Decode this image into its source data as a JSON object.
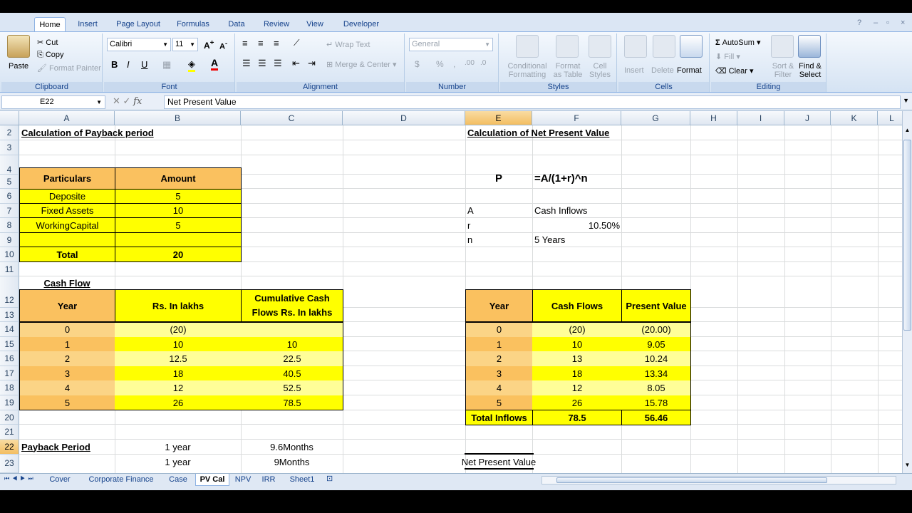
{
  "ribbon_tabs": [
    "Home",
    "Insert",
    "Page Layout",
    "Formulas",
    "Data",
    "Review",
    "View",
    "Developer"
  ],
  "clipboard": {
    "paste": "Paste",
    "cut": "Cut",
    "copy": "Copy",
    "format_painter": "Format Painter",
    "label": "Clipboard"
  },
  "font": {
    "name": "Calibri",
    "size": "11",
    "bold": "B",
    "italic": "I",
    "underline": "U",
    "label": "Font"
  },
  "alignment": {
    "wrap_text": "Wrap Text",
    "merge_center": "Merge & Center",
    "label": "Alignment"
  },
  "number": {
    "format": "General",
    "currency": "$",
    "percent": "%",
    "comma": ",",
    "label": "Number"
  },
  "styles": {
    "conditional": "Conditional",
    "formatting": "Formatting",
    "format_as": "Format",
    "as_table": "as Table",
    "cell": "Cell",
    "cell_styles": "Styles",
    "label": "Styles"
  },
  "cells": {
    "insert": "Insert",
    "delete": "Delete",
    "format": "Format",
    "label": "Cells"
  },
  "editing": {
    "autosum": "AutoSum",
    "fill": "Fill",
    "clear": "Clear",
    "sort": "Sort &",
    "filter": "Filter",
    "find": "Find &",
    "select": "Select",
    "label": "Editing"
  },
  "formula_bar": {
    "name_box": "E22",
    "fx": "fx",
    "content": "Net Present Value"
  },
  "columns": [
    "A",
    "B",
    "C",
    "D",
    "E",
    "F",
    "G",
    "H",
    "I",
    "J",
    "K",
    "L"
  ],
  "rows": [
    "2",
    "3",
    "4",
    "5",
    "6",
    "7",
    "8",
    "9",
    "10",
    "11",
    "12",
    "13",
    "14",
    "15",
    "16",
    "17",
    "18",
    "19",
    "20",
    "21",
    "22",
    "23"
  ],
  "payback": {
    "title": "Calculation of Payback period",
    "headers": [
      "Particulars",
      "Amount"
    ],
    "items": [
      {
        "name": "Deposite",
        "amount": "5"
      },
      {
        "name": "Fixed Assets",
        "amount": "10"
      },
      {
        "name": "WorkingCapital",
        "amount": "5"
      },
      {
        "name": "",
        "amount": ""
      }
    ],
    "total_label": "Total",
    "total_value": "20",
    "cashflow_title": "Cash Flow",
    "cf_headers": [
      "Year",
      "Rs. In lakhs",
      "Cumulative Cash",
      "Flows Rs. In lakhs"
    ],
    "cf_rows": [
      [
        "0",
        "(20)",
        ""
      ],
      [
        "1",
        "10",
        "10"
      ],
      [
        "2",
        "12.5",
        "22.5"
      ],
      [
        "3",
        "18",
        "40.5"
      ],
      [
        "4",
        "12",
        "52.5"
      ],
      [
        "5",
        "26",
        "78.5"
      ]
    ],
    "period_label": "Payback Period",
    "period_rows": [
      [
        "1 year",
        "9.6Months"
      ],
      [
        "1 year",
        "9Months"
      ]
    ]
  },
  "npv": {
    "title": "Calculation of Net Present Value",
    "p": "P",
    "formula": "=A/(1+r)^n",
    "vars": [
      {
        "k": "A",
        "v": "Cash Inflows"
      },
      {
        "k": "r",
        "v": "10.50%"
      },
      {
        "k": "n",
        "v": "5 Years"
      }
    ],
    "headers": [
      "Year",
      "Cash Flows",
      "Present Value"
    ],
    "rows": [
      [
        "0",
        "(20)",
        "(20.00)"
      ],
      [
        "1",
        "10",
        "9.05"
      ],
      [
        "2",
        "13",
        "10.24"
      ],
      [
        "3",
        "18",
        "13.34"
      ],
      [
        "4",
        "12",
        "8.05"
      ],
      [
        "5",
        "26",
        "15.78"
      ]
    ],
    "total": [
      "Total Inflows",
      "78.5",
      "56.46"
    ],
    "npv_label": "Net Present Value"
  },
  "sheets": [
    "Cover",
    "Corporate Finance",
    "Case",
    "PV Cal",
    "NPV",
    "IRR",
    "Sheet1"
  ],
  "active_sheet": "PV Cal"
}
